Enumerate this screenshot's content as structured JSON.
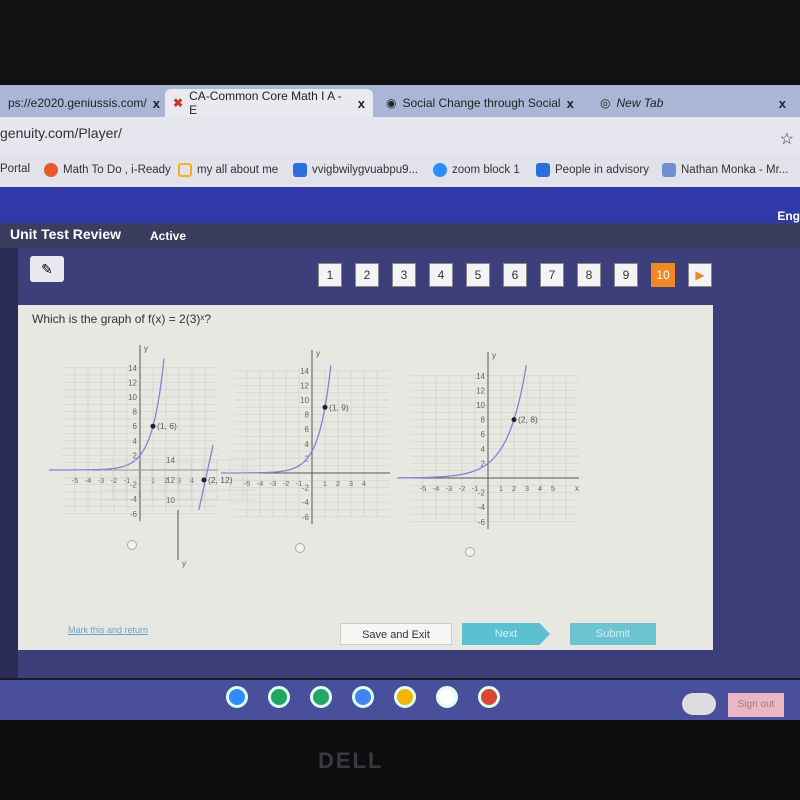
{
  "browser": {
    "tabs": [
      {
        "label": "ps://e2020.geniussis.com/",
        "icon": "page-icon"
      },
      {
        "label": "CA-Common Core Math I A - E",
        "icon": "edgenuity-x-icon"
      },
      {
        "label": "Social Change through Social",
        "icon": "globe-icon"
      },
      {
        "label": "New Tab",
        "icon": "chrome-icon"
      }
    ],
    "close": "x",
    "url": "genuity.com/Player/",
    "star": "☆",
    "bookmarks": [
      {
        "label": "Portal",
        "color": ""
      },
      {
        "label": "Math To Do , i-Ready",
        "color": "#e45a2b"
      },
      {
        "label": "my all about me",
        "color": "#f2b21b"
      },
      {
        "label": "vvigbwilygvuabpu9...",
        "color": "#2a6fdc"
      },
      {
        "label": "zoom block 1",
        "color": "#2d8cff"
      },
      {
        "label": "People in advisory",
        "color": "#2a6fdc"
      },
      {
        "label": "Nathan Monka - Mr...",
        "color": "#6d8fd0"
      }
    ]
  },
  "header": {
    "lang": "Eng",
    "title": "Unit Test Review",
    "status": "Active"
  },
  "nav": {
    "questions": [
      "1",
      "2",
      "3",
      "4",
      "5",
      "6",
      "7",
      "8",
      "9",
      "10"
    ],
    "current": "10",
    "next_arrow": "▶"
  },
  "question": {
    "text": "Which is the graph of f(x) = 2(3)ˣ?"
  },
  "options": [
    {
      "point_label": "(1, 6)",
      "point": [
        1,
        6
      ],
      "xticks": [
        "-5",
        "-4",
        "-3",
        "-2",
        "-1",
        "1",
        "2",
        "3",
        "4"
      ],
      "yticks": [
        "14",
        "12",
        "10",
        "8",
        "6",
        "4",
        "2",
        "-2",
        "-4",
        "-6"
      ]
    },
    {
      "point_label": "(1, 9)",
      "point": [
        1,
        9
      ],
      "xticks": [
        "-5",
        "-4",
        "-3",
        "-2",
        "-1",
        "1",
        "2",
        "3",
        "4"
      ],
      "yticks": [
        "14",
        "12",
        "10",
        "8",
        "6",
        "4",
        "2",
        "-2",
        "-4",
        "-6"
      ]
    },
    {
      "point_label": "(2, 8)",
      "point": [
        2,
        8
      ],
      "xticks": [
        "-5",
        "-4",
        "-3",
        "-2",
        "-1",
        "1",
        "2",
        "3",
        "4",
        "5"
      ],
      "yticks": [
        "14",
        "12",
        "10",
        "8",
        "6",
        "4",
        "2",
        "-2",
        "-4",
        "-6"
      ],
      "xlabel": "x"
    },
    {
      "point_label": "(2, 12)",
      "point": [
        2,
        12
      ],
      "yticks": [
        "14",
        "12",
        "10"
      ]
    }
  ],
  "axis_label_y": "y",
  "footer": {
    "mark": "Mark this and return",
    "save": "Save and Exit",
    "next": "Next",
    "submit": "Submit"
  },
  "taskbar": {
    "sign_out": "Sign out",
    "apps": [
      "zoom",
      "meet",
      "classroom",
      "docs",
      "slides",
      "drive",
      "chrome"
    ]
  },
  "bezel": {
    "brand": "DELL"
  },
  "colors": {
    "accent": "#f08a24",
    "header": "#2f3aa8",
    "curve": "#7b86d8",
    "button": "#5bc0d0"
  }
}
